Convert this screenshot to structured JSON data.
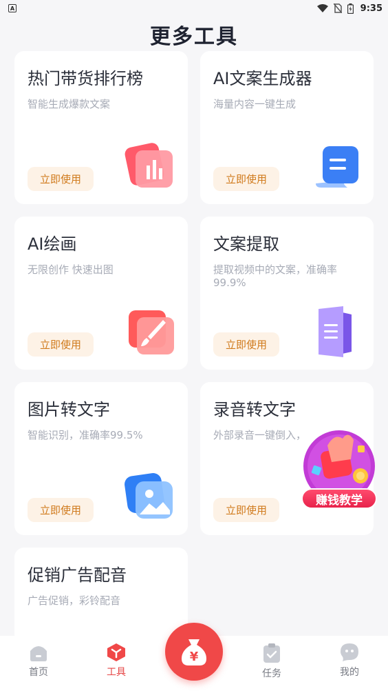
{
  "status": {
    "time": "9:35",
    "indicator": "A"
  },
  "page": {
    "title": "更多工具"
  },
  "cards": [
    {
      "title": "热门带货排行榜",
      "desc": "智能生成爆款文案",
      "button": "立即使用",
      "icon": "chart-icon"
    },
    {
      "title": "AI文案生成器",
      "desc": "海量内容一键生成",
      "button": "立即使用",
      "icon": "document-icon"
    },
    {
      "title": "AI绘画",
      "desc": "无限创作 快速出图",
      "button": "立即使用",
      "icon": "brush-icon"
    },
    {
      "title": "文案提取",
      "desc": "提取视频中的文案，准确率99.9%",
      "button": "立即使用",
      "icon": "text-extract-icon"
    },
    {
      "title": "图片转文字",
      "desc": "智能识别，准确率99.5%",
      "button": "立即使用",
      "icon": "image-icon"
    },
    {
      "title": "录音转文字",
      "desc": "外部录音一键倒入，",
      "button": "立即使用",
      "icon": ""
    },
    {
      "title": "促销广告配音",
      "desc": "广告促销，彩铃配音",
      "button": "",
      "icon": ""
    }
  ],
  "floating_badge": {
    "label": "赚钱教学"
  },
  "nav": {
    "home": "首页",
    "tools": "工具",
    "tasks": "任务",
    "mine": "我的",
    "center_symbol": "¥"
  },
  "colors": {
    "accent": "#f04848",
    "button_bg": "#fdf2e6",
    "button_text": "#d07a1c",
    "page_bg": "#f6f6f8"
  }
}
